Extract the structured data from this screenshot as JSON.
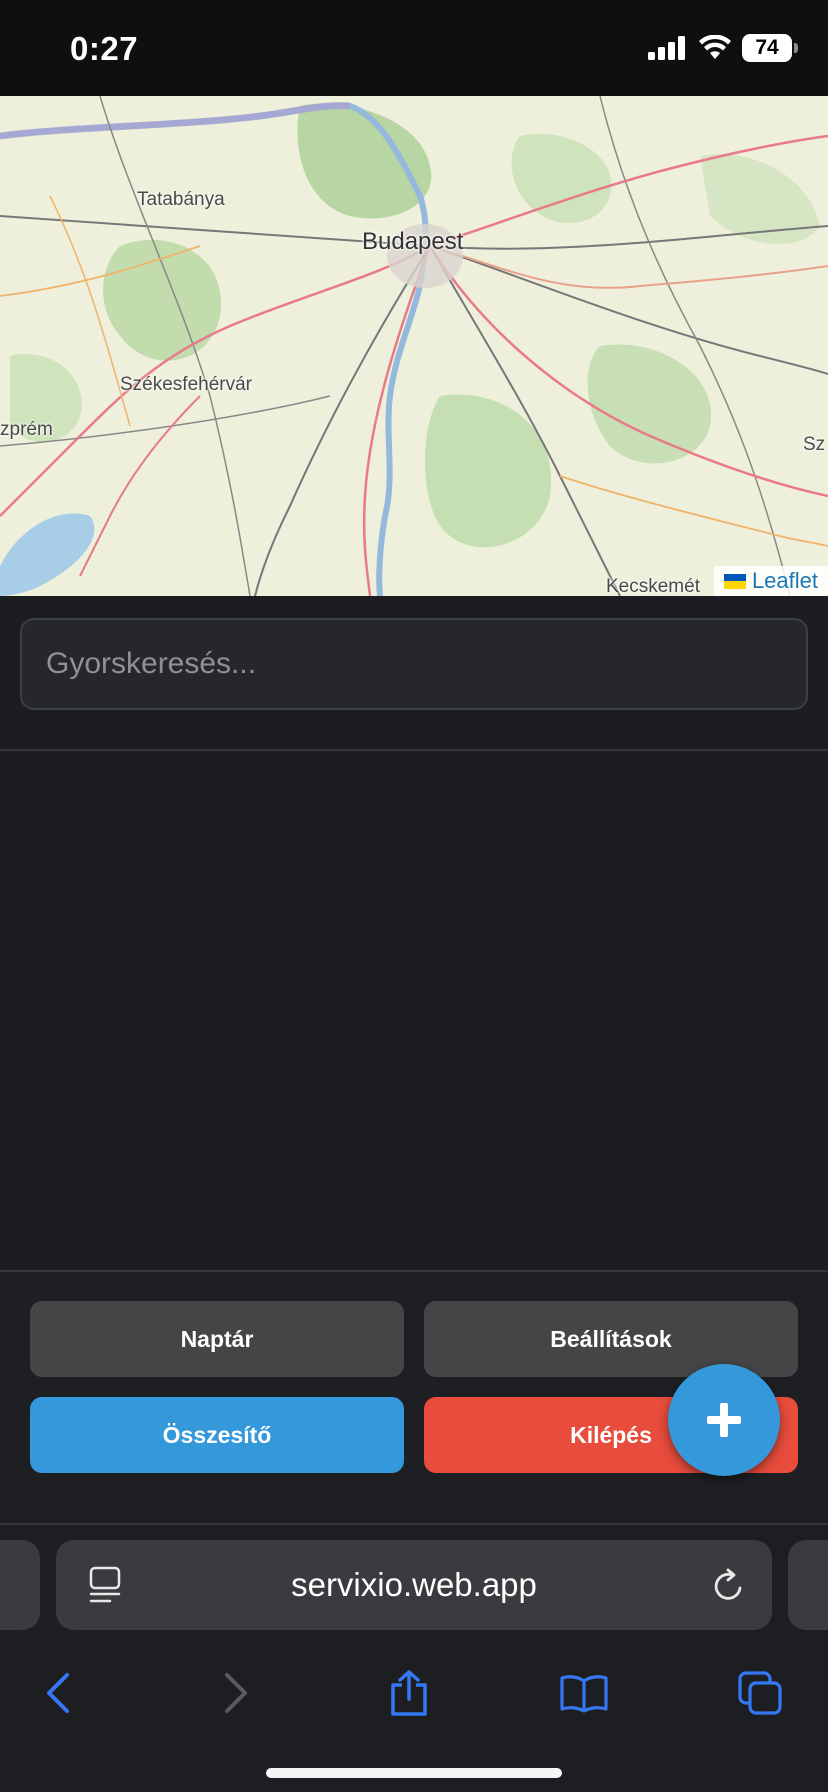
{
  "status_bar": {
    "time": "0:27",
    "battery": "74"
  },
  "map": {
    "labels": {
      "budapest": "Budapest",
      "tatabanya": "Tatabánya",
      "szekesfehervar": "Székesfehérvár",
      "veszprem": "zprém",
      "kecskemet": "Kecskemét",
      "szolnok": "Sz"
    },
    "attribution": "Leaflet"
  },
  "search": {
    "placeholder": "Gyorskeresés..."
  },
  "actions": {
    "calendar": "Naptár",
    "settings": "Beállítások",
    "summary": "Összesítő",
    "logout": "Kilépés",
    "add": "+"
  },
  "browser": {
    "url": "servixio.web.app"
  },
  "colors": {
    "accent_blue": "#3498db",
    "danger_red": "#e74c3c",
    "button_gray": "#444547",
    "ios_blue": "#3478f6"
  }
}
